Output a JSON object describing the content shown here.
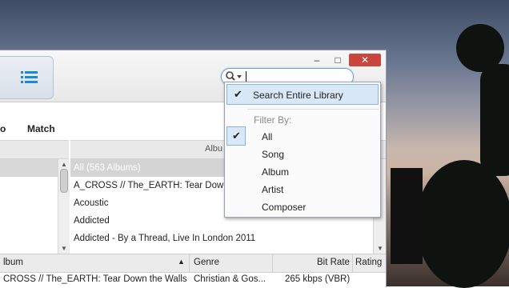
{
  "app": {
    "menu": [
      "o",
      "Match"
    ],
    "column_album": "Albu"
  },
  "search": {
    "value": "",
    "placeholder": ""
  },
  "dropdown": {
    "top_item": "Search Entire Library",
    "filter_header": "Filter By:",
    "items": [
      "All",
      "Song",
      "Album",
      "Artist",
      "Composer"
    ],
    "checked": "All"
  },
  "albums": [
    "All (563 Albums)",
    "A_CROSS // The_EARTH: Tear Down",
    "Acoustic",
    "Addicted",
    "Addicted - By a Thread, Live In London 2011"
  ],
  "table": {
    "headers": [
      "lbum",
      "Genre",
      "Bit Rate",
      "Rating"
    ],
    "row": [
      "CROSS // The_EARTH: Tear Down the Walls",
      "Christian & Gos...",
      "265 kbps (VBR)",
      ""
    ]
  },
  "colors": {
    "accent": "#1e88d8",
    "close": "#c9463d"
  },
  "icons": [
    "list-view-icon",
    "search-icon",
    "minimize-icon",
    "maximize-icon",
    "close-icon",
    "checkmark-icon",
    "sort-arrow-icon"
  ]
}
